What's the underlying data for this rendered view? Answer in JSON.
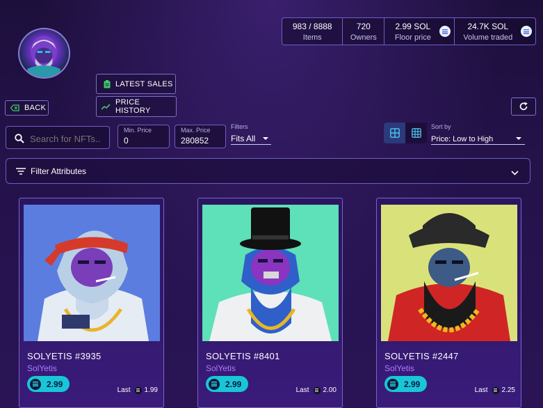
{
  "stats": [
    {
      "value": "983 / 8888",
      "label": "Items"
    },
    {
      "value": "720",
      "label": "Owners"
    },
    {
      "value": "2.99 SOL",
      "label": "Floor price"
    },
    {
      "value": "24.7K SOL",
      "label": "Volume traded"
    }
  ],
  "buttons": {
    "latest_sales": "LATEST SALES",
    "price_history": "PRICE HISTORY",
    "back": "BACK"
  },
  "search": {
    "placeholder": "Search for NFTs..",
    "value": ""
  },
  "min_price": {
    "label": "Min. Price",
    "value": "0"
  },
  "max_price": {
    "label": "Max. Price",
    "value": "280852"
  },
  "filters": {
    "label": "Filters",
    "value": "Fits All"
  },
  "sort": {
    "label": "Sort by",
    "value": "Price: Low to High"
  },
  "filter_attributes": "Filter Attributes",
  "cards": [
    {
      "name": "SOLYETIS #3935",
      "collection": "SolYetis",
      "price": "2.99",
      "last_label": "Last",
      "last_value": "1.99",
      "bg": "#5b7de0"
    },
    {
      "name": "SOLYETIS #8401",
      "collection": "SolYetis",
      "price": "2.99",
      "last_label": "Last",
      "last_value": "2.00",
      "bg": "#5ee0b8"
    },
    {
      "name": "SOLYETIS #2447",
      "collection": "SolYetis",
      "price": "2.99",
      "last_label": "Last",
      "last_value": "2.25",
      "bg": "#d9e27a"
    }
  ],
  "colors": {
    "accent": "#18c6d8",
    "border": "#6d5fc4",
    "collection_text": "#b07aff"
  }
}
